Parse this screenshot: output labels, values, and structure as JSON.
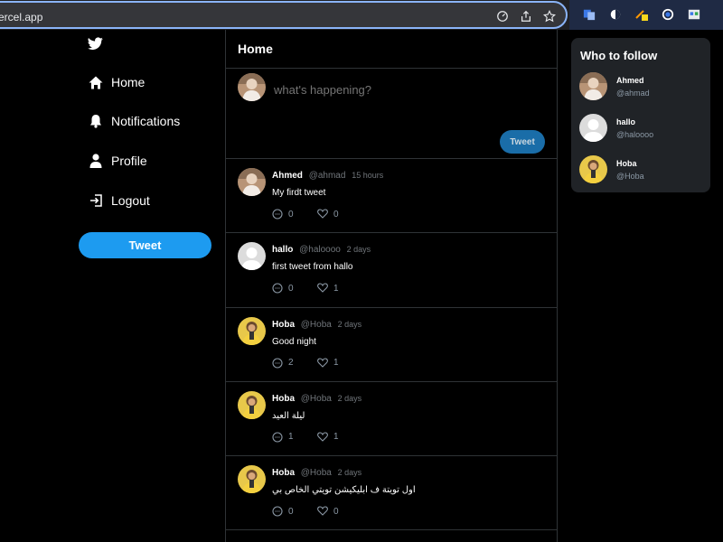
{
  "browser": {
    "url": "e.vercel.app"
  },
  "nav": {
    "items": [
      {
        "label": "Home",
        "icon": "home-icon"
      },
      {
        "label": "Notifications",
        "icon": "bell-icon"
      },
      {
        "label": "Profile",
        "icon": "user-icon"
      },
      {
        "label": "Logout",
        "icon": "logout-icon"
      }
    ],
    "tweet_button": "Tweet"
  },
  "main": {
    "title": "Home",
    "composer": {
      "placeholder": "what's happening?",
      "button": "Tweet"
    },
    "tweets": [
      {
        "name": "Ahmed",
        "handle": "@ahmad",
        "time": "15 hours",
        "text": "My firdt tweet",
        "replies": "0",
        "likes": "0",
        "avatar": "photo"
      },
      {
        "name": "hallo",
        "handle": "@haloooo",
        "time": "2 days",
        "text": "first tweet from hallo",
        "replies": "0",
        "likes": "1",
        "avatar": "default"
      },
      {
        "name": "Hoba",
        "handle": "@Hoba",
        "time": "2 days",
        "text": "Good night",
        "replies": "2",
        "likes": "1",
        "avatar": "yellow"
      },
      {
        "name": "Hoba",
        "handle": "@Hoba",
        "time": "2 days",
        "text": "ليلة العيد",
        "replies": "1",
        "likes": "1",
        "avatar": "yellow"
      },
      {
        "name": "Hoba",
        "handle": "@Hoba",
        "time": "2 days",
        "text": "اول تويتة ف ابليكيشن تويتي الخاص بي",
        "replies": "0",
        "likes": "0",
        "avatar": "yellow"
      }
    ]
  },
  "right": {
    "title": "Who to follow",
    "users": [
      {
        "name": "Ahmed",
        "handle": "@ahmad"
      },
      {
        "name": "hallo",
        "handle": "@haloooo"
      },
      {
        "name": "Hoba",
        "handle": "@Hoba"
      }
    ]
  },
  "colors": {
    "accent": "#1d9bf0",
    "background": "#000000",
    "panel": "#202327"
  }
}
